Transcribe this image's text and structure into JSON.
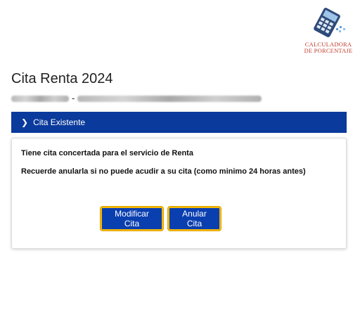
{
  "logo": {
    "line1": "CALCULADORA",
    "line2": "DE PORCENTAJE",
    "icon": "calculator-icon"
  },
  "header": {
    "title": "Cita Renta 2024",
    "separator": "-"
  },
  "accordion": {
    "label": "Cita Existente",
    "icon": "chevron-right-icon"
  },
  "card": {
    "message1": "Tiene cita concertada para el servicio de Renta",
    "message2": "Recuerde anularla si no puede acudir a su cita (como minimo 24 horas antes)",
    "modify_label": "Modificar Cita",
    "cancel_label": "Anular Cita"
  },
  "colors": {
    "primary": "#0a3a9c",
    "button_border": "#f5b800",
    "logo_red": "#c0392b"
  }
}
